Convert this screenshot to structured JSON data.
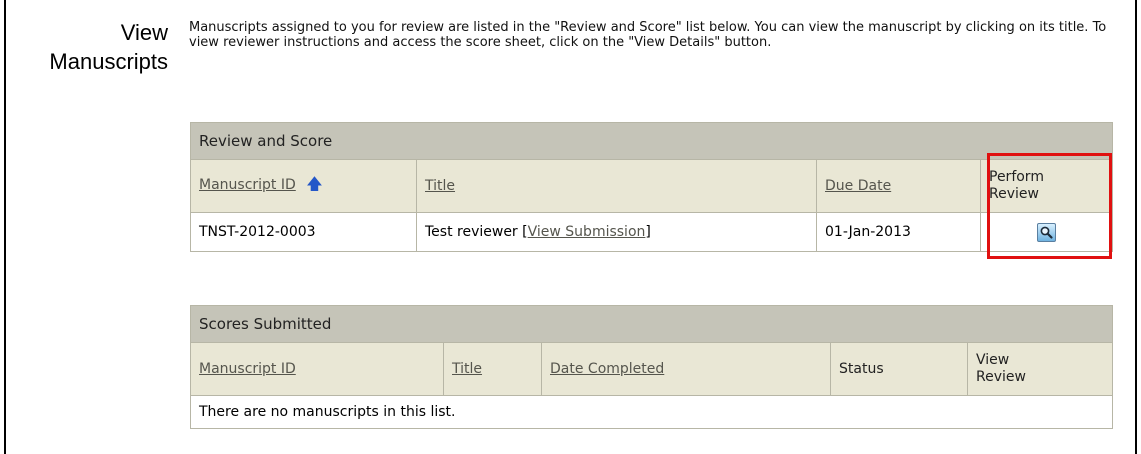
{
  "page": {
    "side_title_line1": "View",
    "side_title_line2": "Manuscripts",
    "intro": "Manuscripts assigned to you for review are listed in the \"Review and Score\" list below. You can view the manuscript by clicking on its title. To view reviewer instructions and access the score sheet, click on the \"View Details\" button."
  },
  "review_table": {
    "caption": "Review and Score",
    "col_manuscript_id": "Manuscript ID",
    "col_title": "Title",
    "col_due_date": "Due Date",
    "col_perform_line1": "Perform",
    "col_perform_line2": "Review",
    "sort_icon": "arrow-up-icon",
    "rows": [
      {
        "manuscript_id": "TNST-2012-0003",
        "title": "Test reviewer",
        "title_link_open": "[",
        "view_submission": "View Submission",
        "title_link_close": "]",
        "due_date": "01-Jan-2013",
        "action_icon": "magnifier-icon"
      }
    ]
  },
  "scores_table": {
    "caption": "Scores Submitted",
    "col_manuscript_id": "Manuscript ID",
    "col_title": "Title",
    "col_date_completed": "Date Completed",
    "col_status": "Status",
    "col_view_line1": "View",
    "col_view_line2": "Review",
    "empty_message": "There are no manuscripts in this list."
  },
  "colors": {
    "caption_bg": "#c5c4b8",
    "header_bg": "#e9e7d5",
    "highlight": "#e01010",
    "sort_arrow": "#2457c8"
  }
}
